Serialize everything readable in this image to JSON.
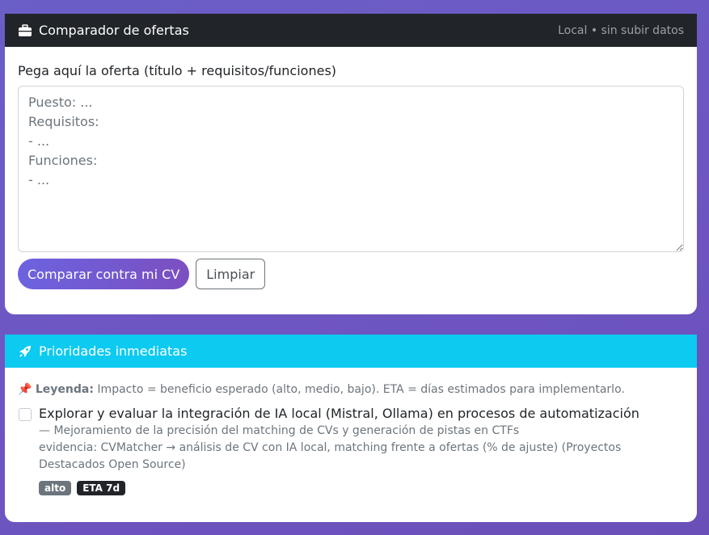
{
  "comparator": {
    "icon": "briefcase-icon",
    "title": "Comparador de ofertas",
    "subtitle": "Local • sin subir datos",
    "label": "Pega aquí la oferta (título + requisitos/funciones)",
    "textarea_placeholder": "Puesto: ...\nRequisitos:\n- ...\nFunciones:\n- ...",
    "textarea_value": "",
    "compare_button": "Comparar contra mi CV",
    "clear_button": "Limpiar"
  },
  "priorities": {
    "icon": "rocket-icon",
    "title": "Prioridades inmediatas",
    "legend_icon": "📌",
    "legend_label": "Leyenda:",
    "legend_text": "Impacto = beneficio esperado (alto, medio, bajo). ETA = días estimados para implementarlo.",
    "items": [
      {
        "checked": false,
        "title": "Explorar y evaluar la integración de IA local (Mistral, Ollama) en procesos de automatización",
        "benefit": "— Mejoramiento de la precisión del matching de CVs y generación de pistas en CTFs",
        "evidence": "evidencia: CVMatcher → análisis de CV con IA local, matching frente a ofertas (% de ajuste) (Proyectos Destacados Open Source)",
        "impact_badge": "alto",
        "eta_badge": "ETA 7d"
      }
    ]
  },
  "colors": {
    "background": "#6a5fc6",
    "header_dark": "#212529",
    "header_cyan": "#0dcaf0",
    "primary_gradient_start": "#6c63e0",
    "primary_gradient_end": "#7b4fc0"
  }
}
